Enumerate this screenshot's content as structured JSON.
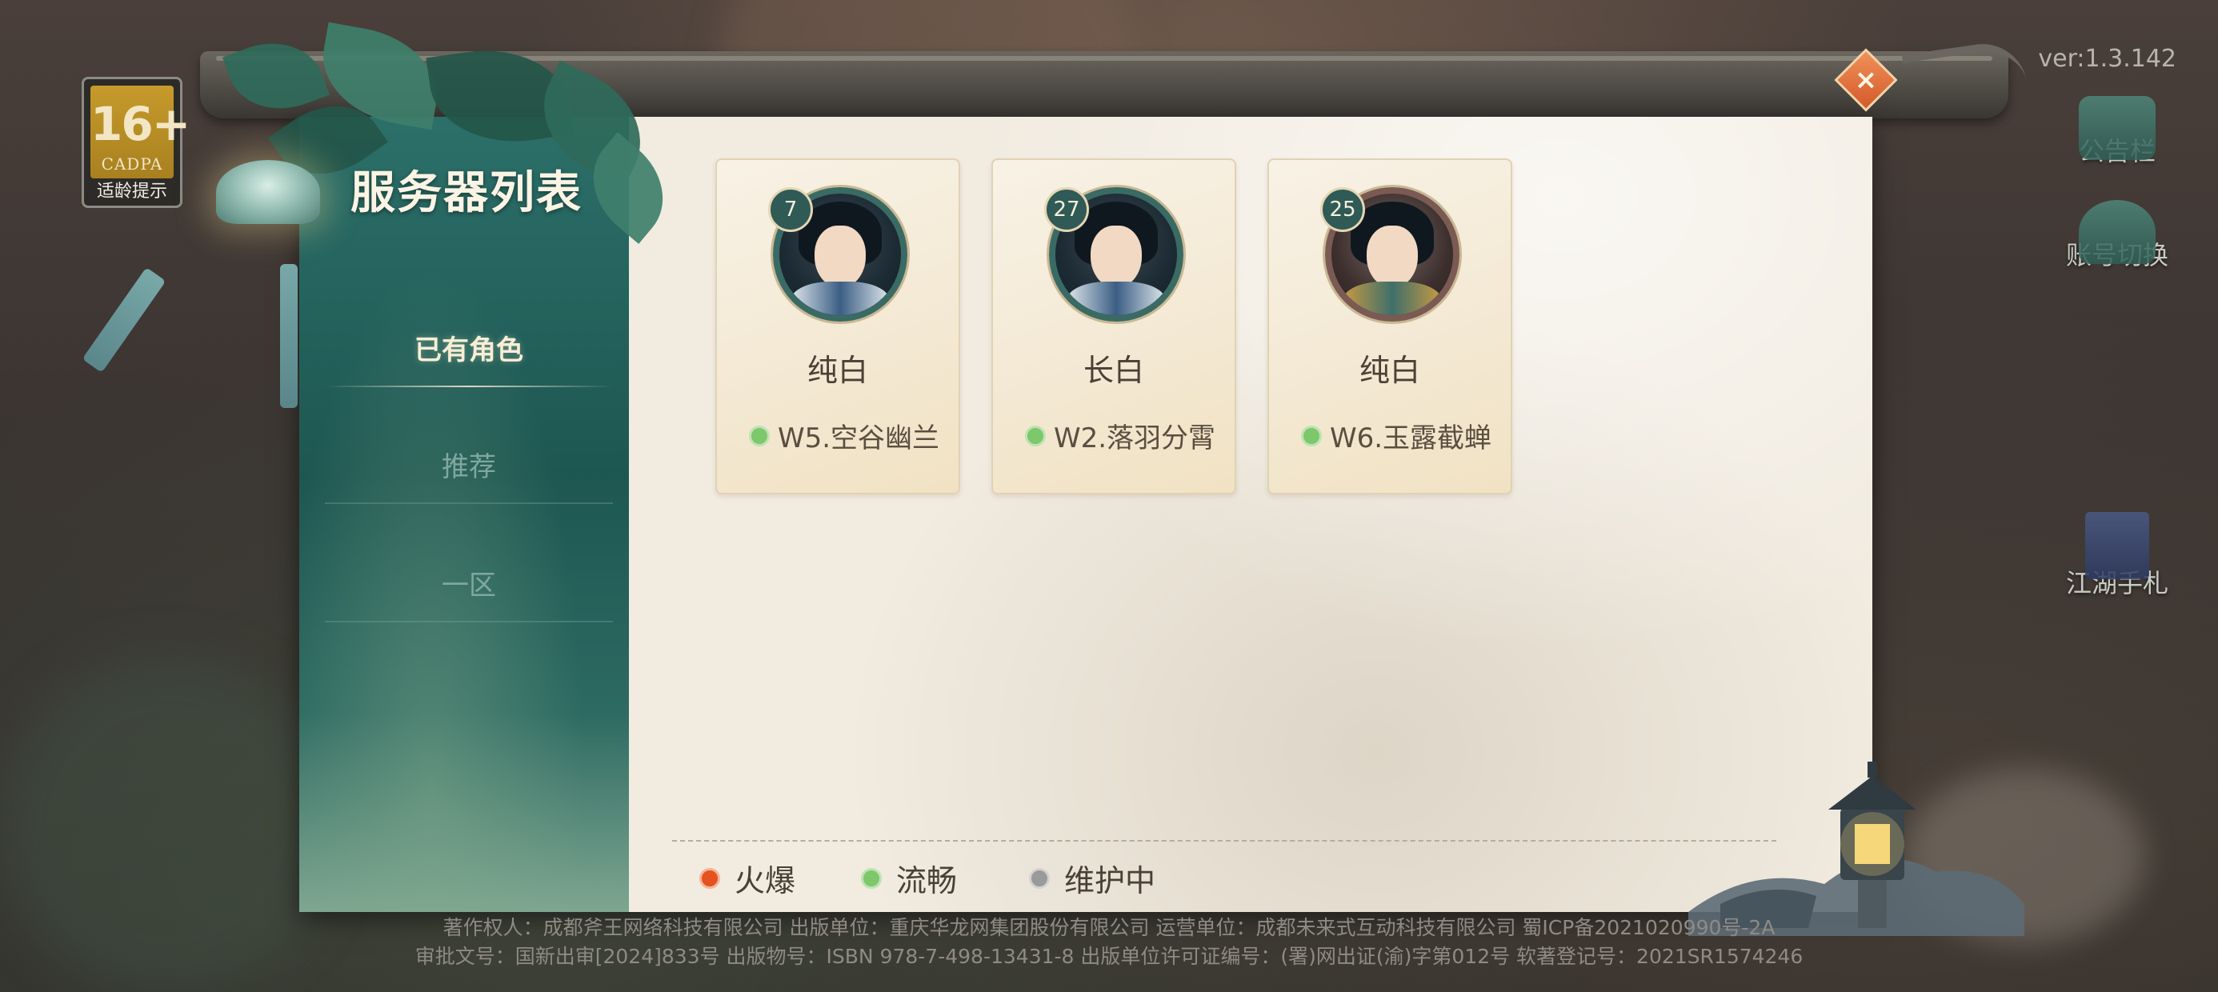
{
  "age_rating": {
    "number": "16+",
    "org": "CADPA",
    "tip": "适龄提示"
  },
  "title": "服务器列表",
  "close_icon": "close-x-icon",
  "version": "ver:1.3.142",
  "tabs": [
    {
      "label": "已有角色",
      "active": true
    },
    {
      "label": "推荐",
      "active": false
    },
    {
      "label": "一区",
      "active": false
    }
  ],
  "characters": [
    {
      "level": "7",
      "name": "纯白",
      "server": "W5.空谷幽兰",
      "status": "流畅"
    },
    {
      "level": "27",
      "name": "长白",
      "server": "W2.落羽分霄",
      "status": "流畅"
    },
    {
      "level": "25",
      "name": "纯白",
      "server": "W6.玉露截蝉",
      "status": "流畅"
    }
  ],
  "legend": [
    {
      "label": "火爆",
      "color": "#e3521f",
      "ring": "#f4b49a"
    },
    {
      "label": "流畅",
      "color": "#7cc86a",
      "ring": "#bfe3b3"
    },
    {
      "label": "维护中",
      "color": "#9a9a9a",
      "ring": "#d2d2d2"
    }
  ],
  "side_buttons": [
    {
      "label": "公告栏",
      "icon": "notice-board-icon"
    },
    {
      "label": "账号切换",
      "icon": "account-switch-icon"
    },
    {
      "label": "江湖手札",
      "icon": "journal-book-icon"
    }
  ],
  "colors": {
    "status_smooth": "#7cc86a",
    "status_hot": "#e3521f",
    "status_maintenance": "#9a9a9a",
    "sidebar": "#1e5752",
    "panel": "#f1ebe0"
  },
  "copyright": {
    "line1": "著作权人：成都斧王网络科技有限公司 出版单位：重庆华龙网集团股份有限公司 运营单位：成都未来式互动科技有限公司 蜀ICP备2021020990号-2A",
    "line2": "审批文号：国新出审[2024]833号 出版物号：ISBN 978-7-498-13431-8 出版单位许可证编号：(署)网出证(渝)字第012号 软著登记号：2021SR1574246"
  }
}
